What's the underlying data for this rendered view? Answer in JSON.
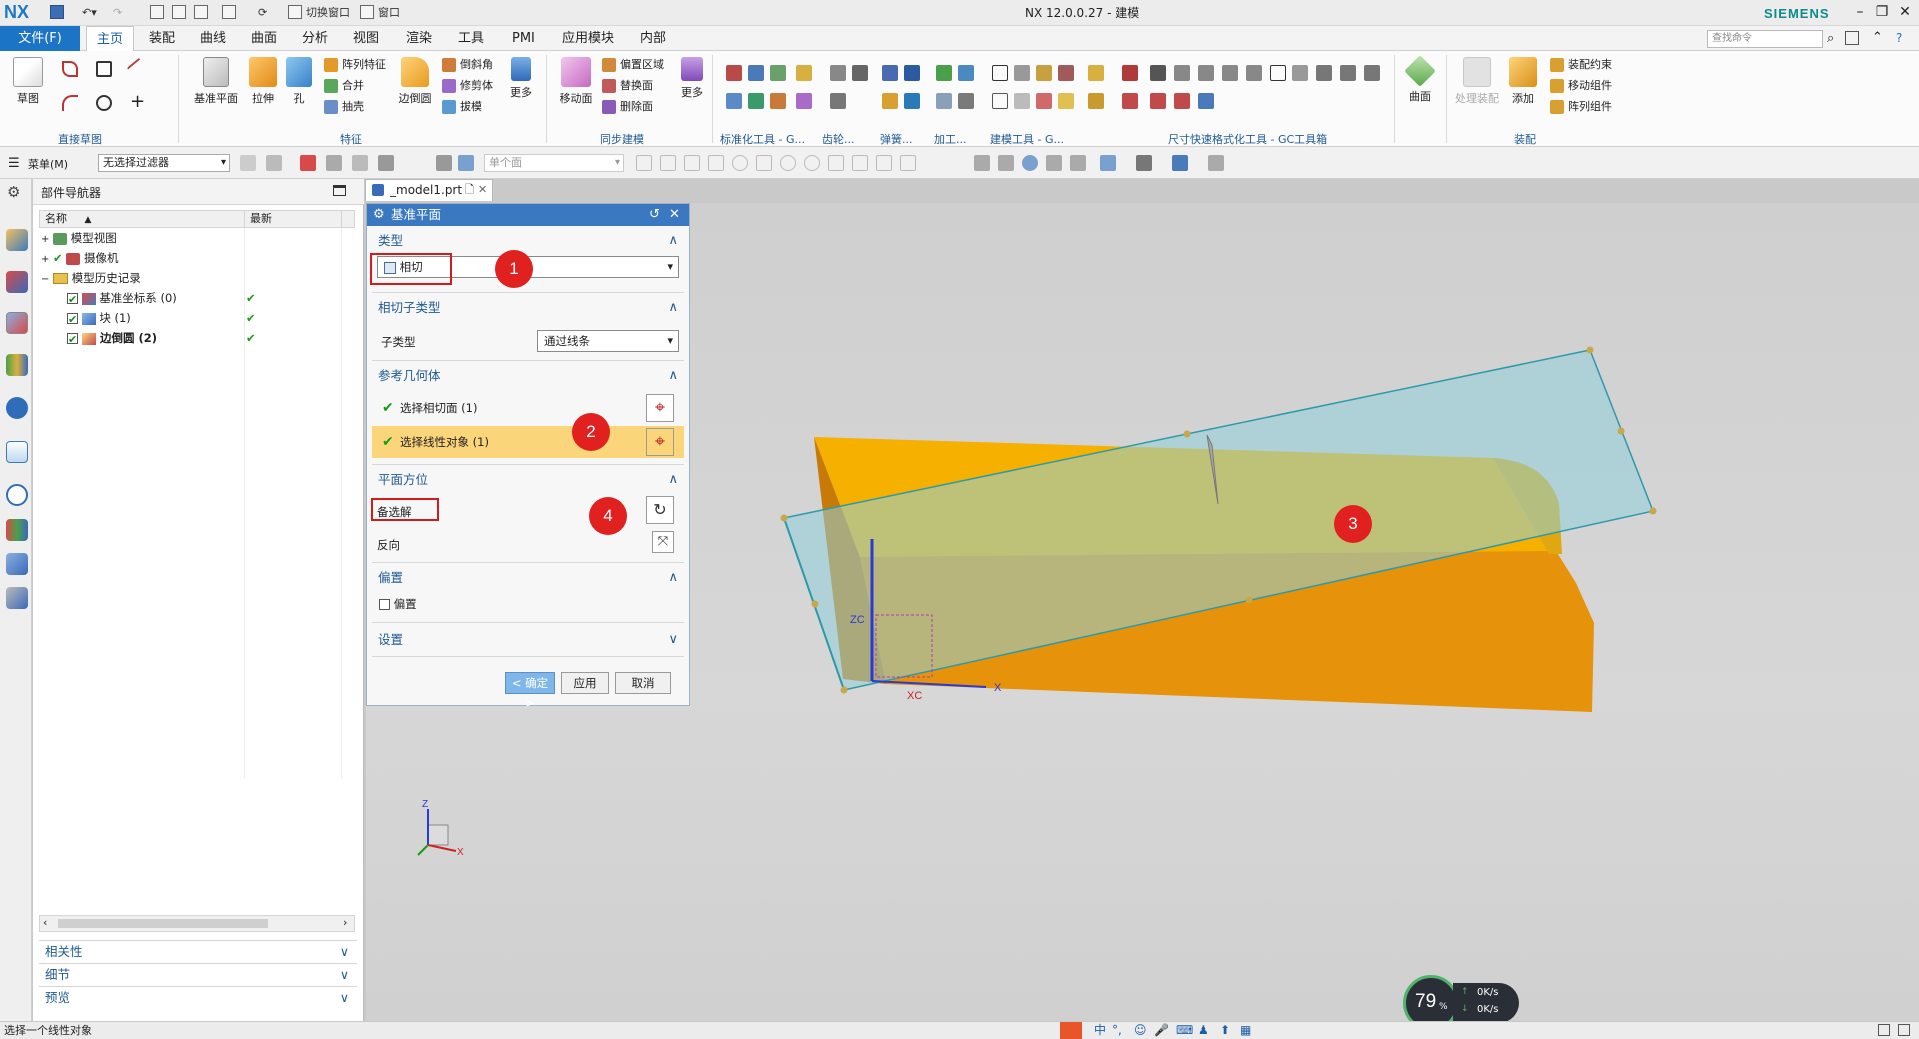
{
  "window": {
    "title": "NX 12.0.0.27 - 建模",
    "brand": "SIEMENS",
    "logo": "NX"
  },
  "quickaccess": {
    "switch_window": "切换窗口",
    "window": "窗口"
  },
  "menu": {
    "file": "文件(F)",
    "tabs": [
      "主页",
      "装配",
      "曲线",
      "曲面",
      "分析",
      "视图",
      "渲染",
      "工具",
      "PMI",
      "应用模块",
      "内部"
    ],
    "active_tab": "主页",
    "search_placeholder": "查找命令"
  },
  "ribbon": {
    "sketch": "草图",
    "datum_plane": "基准平面",
    "extrude": "拉伸",
    "hole": "孔",
    "pattern_feature": "阵列特征",
    "unite": "合并",
    "shell": "抽壳",
    "edge_blend": "边倒圆",
    "chamfer": "倒斜角",
    "trim_body": "修剪体",
    "draft": "拔模",
    "more": "更多",
    "move_face": "移动面",
    "offset_region": "偏置区域",
    "replace_face": "替换面",
    "delete_face": "删除面",
    "more2": "更多",
    "surface": "曲面",
    "process_assembly": "处理装配",
    "add": "添加",
    "assembly_constraint": "装配约束",
    "move_component": "移动组件",
    "pattern_component": "阵列组件",
    "groups": {
      "direct_sketch": "直接草图",
      "feature": "特征",
      "sync_modeling": "同步建模",
      "std_tools": "标准化工具 - G...",
      "gear": "齿轮...",
      "spring": "弹簧...",
      "machining": "加工...",
      "modeling_tools": "建模工具 - G...",
      "dim_tools": "尺寸快速格式化工具 - GC工具箱",
      "assembly": "装配"
    }
  },
  "selbar": {
    "menu": "菜单(M)",
    "filter": "无选择过滤器",
    "scope": "单个面"
  },
  "navigator": {
    "title": "部件导航器",
    "col_name": "名称",
    "col_latest": "最新",
    "rows": [
      {
        "label": "模型视图"
      },
      {
        "label": "摄像机"
      },
      {
        "label": "模型历史记录"
      },
      {
        "label": "基准坐标系 (0)",
        "check": "✔"
      },
      {
        "label": "块 (1)",
        "check": "✔"
      },
      {
        "label": "边倒圆 (2)",
        "check": "✔"
      }
    ],
    "panels": [
      "相关性",
      "细节",
      "预览"
    ]
  },
  "file_tab": {
    "name": "_model1.prt"
  },
  "dialog": {
    "title": "基准平面",
    "sec_type": "类型",
    "type_value": "相切",
    "sec_subtype": "相切子类型",
    "subtype_label": "子类型",
    "subtype_value": "通过线条",
    "sec_ref": "参考几何体",
    "sel_tangent": "选择相切面 (1)",
    "sel_linear": "选择线性对象 (1)",
    "sec_orient": "平面方位",
    "alternate": "备选解",
    "reverse": "反向",
    "sec_offset": "偏置",
    "offset_label": "偏置",
    "sec_settings": "设置",
    "ok": "< 确定 >",
    "apply": "应用",
    "cancel": "取消"
  },
  "callouts": [
    "1",
    "2",
    "3",
    "4"
  ],
  "viewport": {
    "xc": "XC",
    "zc": "ZC",
    "x": "X",
    "z": "Z"
  },
  "status": {
    "message": "选择一个线性对象"
  },
  "gauge": {
    "percent": "79",
    "unit": "%",
    "up": "0K/s",
    "down": "0K/s"
  },
  "colors": {
    "accent": "#1b74c5",
    "body_orange": "#f0a000",
    "plane": "#9fd0d6",
    "callout": "#e12020"
  }
}
